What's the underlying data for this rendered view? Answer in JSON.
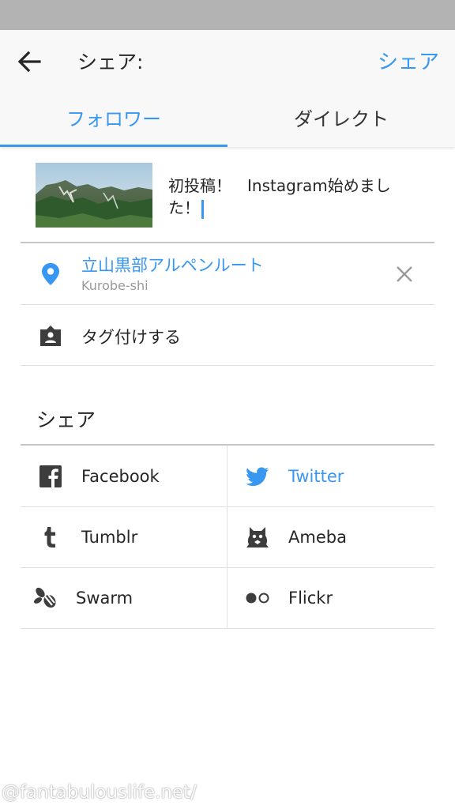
{
  "app_bar": {
    "title": "シェア:",
    "share_action": "シェア"
  },
  "tabs": [
    {
      "label": "フォロワー",
      "selected": true
    },
    {
      "label": "ダイレクト",
      "selected": false
    }
  ],
  "post": {
    "caption": "初投稿！　Instagram始めました！"
  },
  "location": {
    "name": "立山黒部アルペンルート",
    "sub": "Kurobe-shi"
  },
  "tag_people": {
    "label": "タグ付けする"
  },
  "share_section": {
    "heading": "シェア",
    "services": [
      {
        "label": "Facebook",
        "icon": "facebook-icon",
        "active": false
      },
      {
        "label": "Twitter",
        "icon": "twitter-icon",
        "active": true
      },
      {
        "label": "Tumblr",
        "icon": "tumblr-icon",
        "active": false
      },
      {
        "label": "Ameba",
        "icon": "ameba-icon",
        "active": false
      },
      {
        "label": "Swarm",
        "icon": "swarm-icon",
        "active": false
      },
      {
        "label": "Flickr",
        "icon": "flickr-icon",
        "active": false
      }
    ]
  },
  "watermark": "@fantabulouslife.net/",
  "colors": {
    "accent": "#3897f0",
    "text": "#262626",
    "muted": "#999999",
    "icon": "#3d3d3d"
  }
}
